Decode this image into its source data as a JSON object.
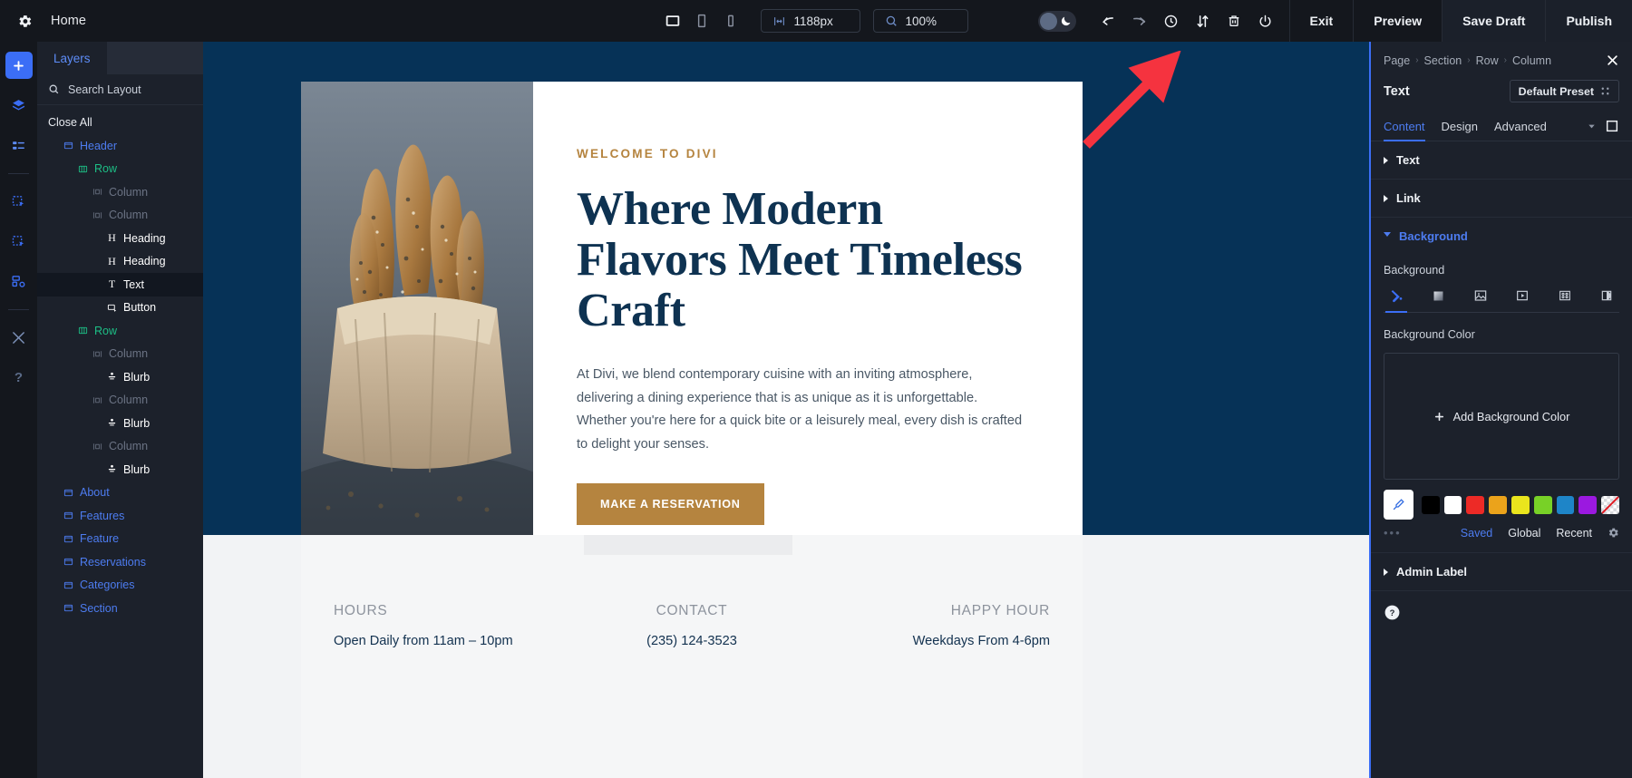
{
  "topbar": {
    "gear_icon": "gear-icon",
    "home_label": "Home",
    "devices": [
      {
        "name": "desktop-view",
        "icon": "desktop-icon"
      },
      {
        "name": "tablet-view",
        "icon": "tablet-icon"
      },
      {
        "name": "phone-view",
        "icon": "phone-icon"
      }
    ],
    "width_value": "1188px",
    "width_icon": "width-arrows-icon",
    "zoom_value": "100%",
    "zoom_icon": "magnifier-icon",
    "dark_mode_icon": "moon-icon",
    "actions": [
      {
        "name": "undo-button",
        "icon": "undo-icon"
      },
      {
        "name": "redo-button",
        "icon": "redo-icon"
      },
      {
        "name": "history-button",
        "icon": "clock-icon"
      },
      {
        "name": "sort-button",
        "icon": "updown-arrows-icon"
      },
      {
        "name": "trash-button",
        "icon": "trash-icon"
      },
      {
        "name": "power-button",
        "icon": "power-icon"
      }
    ],
    "exit_label": "Exit",
    "preview_label": "Preview",
    "save_draft_label": "Save Draft",
    "publish_label": "Publish"
  },
  "rail": {
    "items": [
      {
        "name": "add-module",
        "icon": "plus-icon",
        "active": true
      },
      {
        "name": "layers",
        "icon": "layers-icon",
        "active": false
      },
      {
        "name": "list-view",
        "icon": "list-icon",
        "active": false
      },
      {
        "name": "clipboard-select",
        "icon": "select-copy-icon",
        "active": false
      },
      {
        "name": "clipboard-paste",
        "icon": "select-paste-icon",
        "active": false
      },
      {
        "name": "structure",
        "icon": "structure-icon",
        "active": false
      },
      {
        "name": "tools",
        "icon": "wrench-icon",
        "active": false
      },
      {
        "name": "help",
        "icon": "question-icon",
        "active": false
      }
    ]
  },
  "layers": {
    "tab_label": "Layers",
    "search_placeholder": "Search Layout",
    "search_value": "",
    "search_icon": "search-icon",
    "filter_icon": "filter-icon",
    "close_all_label": "Close All",
    "tree": [
      {
        "label": "Header",
        "type": "section",
        "indent": 1,
        "icon": "section-icon",
        "selected": false
      },
      {
        "label": "Row",
        "type": "row",
        "indent": 2,
        "icon": "row-icon",
        "selected": false
      },
      {
        "label": "Column",
        "type": "column",
        "indent": 3,
        "icon": "column-icon",
        "selected": false
      },
      {
        "label": "Column",
        "type": "column",
        "indent": 3,
        "icon": "column-icon",
        "selected": false
      },
      {
        "label": "Heading",
        "type": "module",
        "indent": 4,
        "icon": "heading-icon",
        "selected": false
      },
      {
        "label": "Heading",
        "type": "module",
        "indent": 4,
        "icon": "heading-icon",
        "selected": false
      },
      {
        "label": "Text",
        "type": "module",
        "indent": 4,
        "icon": "text-icon",
        "selected": true
      },
      {
        "label": "Button",
        "type": "module",
        "indent": 4,
        "icon": "button-icon",
        "selected": false
      },
      {
        "label": "Row",
        "type": "row",
        "indent": 2,
        "icon": "row-icon",
        "selected": false
      },
      {
        "label": "Column",
        "type": "column",
        "indent": 3,
        "icon": "column-icon",
        "selected": false
      },
      {
        "label": "Blurb",
        "type": "module",
        "indent": 4,
        "icon": "blurb-icon",
        "selected": false
      },
      {
        "label": "Column",
        "type": "column",
        "indent": 3,
        "icon": "column-icon",
        "selected": false
      },
      {
        "label": "Blurb",
        "type": "module",
        "indent": 4,
        "icon": "blurb-icon",
        "selected": false
      },
      {
        "label": "Column",
        "type": "column",
        "indent": 3,
        "icon": "column-icon",
        "selected": false
      },
      {
        "label": "Blurb",
        "type": "module",
        "indent": 4,
        "icon": "blurb-icon",
        "selected": false
      },
      {
        "label": "About",
        "type": "section",
        "indent": 1,
        "icon": "section-icon",
        "selected": false
      },
      {
        "label": "Features",
        "type": "section",
        "indent": 1,
        "icon": "section-icon",
        "selected": false
      },
      {
        "label": "Feature",
        "type": "section",
        "indent": 1,
        "icon": "section-icon",
        "selected": false
      },
      {
        "label": "Reservations",
        "type": "section",
        "indent": 1,
        "icon": "section-icon",
        "selected": false
      },
      {
        "label": "Categories",
        "type": "section",
        "indent": 1,
        "icon": "section-icon",
        "selected": false
      },
      {
        "label": "Section",
        "type": "section",
        "indent": 1,
        "icon": "section-icon",
        "selected": false
      }
    ]
  },
  "canvas": {
    "hero": {
      "eyebrow": "WELCOME TO DIVI",
      "heading": "Where Modern Flavors Meet Timeless Craft",
      "paragraph": "At Divi, we blend contemporary cuisine with an inviting atmosphere, delivering a dining experience that is as unique as it is unforgettable. Whether you're here for a quick bite or a leisurely meal, every dish is crafted to delight your senses.",
      "cta_label": "MAKE A RESERVATION",
      "image_alt": "bagel-sticks-in-paper-bag-photo"
    },
    "info": [
      {
        "heading": "HOURS",
        "value": "Open Daily from 11am – 10pm"
      },
      {
        "heading": "CONTACT",
        "value": "(235) 124-3523"
      },
      {
        "heading": "HAPPY HOUR",
        "value": "Weekdays From 4-6pm"
      }
    ],
    "colors": {
      "page_bg": "#063257",
      "heading": "#0e3251",
      "accent": "#b5843f",
      "band": "#f2f3f5"
    }
  },
  "rpanel": {
    "breadcrumb": [
      "Page",
      "Section",
      "Row",
      "Column"
    ],
    "breadcrumb_sep": "›",
    "close_icon": "close-icon",
    "module_title": "Text",
    "preset_label": "Default Preset",
    "preset_icon": "preset-icon",
    "tabs": [
      {
        "label": "Content",
        "active": true
      },
      {
        "label": "Design",
        "active": false
      },
      {
        "label": "Advanced",
        "active": false
      }
    ],
    "tab_chevron_icon": "chevron-down-icon",
    "tab_expand_icon": "expand-square-icon",
    "sections": [
      {
        "label": "Text",
        "open": false
      },
      {
        "label": "Link",
        "open": false
      },
      {
        "label": "Background",
        "open": true
      },
      {
        "label": "Admin Label",
        "open": false
      }
    ],
    "background": {
      "field_label": "Background",
      "types": [
        {
          "name": "bg-color-tab",
          "icon": "paint-bucket-icon",
          "active": true
        },
        {
          "name": "bg-gradient-tab",
          "icon": "gradient-icon",
          "active": false
        },
        {
          "name": "bg-image-tab",
          "icon": "image-icon",
          "active": false
        },
        {
          "name": "bg-video-tab",
          "icon": "video-icon",
          "active": false
        },
        {
          "name": "bg-pattern-tab",
          "icon": "pattern-icon",
          "active": false
        },
        {
          "name": "bg-mask-tab",
          "icon": "mask-icon",
          "active": false
        }
      ],
      "color_label": "Background Color",
      "add_color_label": "Add Background Color",
      "add_icon": "plus-icon",
      "eyedropper_icon": "eyedropper-icon",
      "swatches": [
        "#000000",
        "#ffffff",
        "#ed2a26",
        "#eba31b",
        "#eae51d",
        "#78d127",
        "#1e85c8",
        "#9b19e0",
        "transparent"
      ],
      "more_dots": "•••",
      "links": [
        {
          "label": "Saved",
          "active": true
        },
        {
          "label": "Global",
          "active": false
        },
        {
          "label": "Recent",
          "active": false
        }
      ],
      "settings_icon": "gear-icon"
    },
    "help_icon": "question-circle-icon"
  }
}
